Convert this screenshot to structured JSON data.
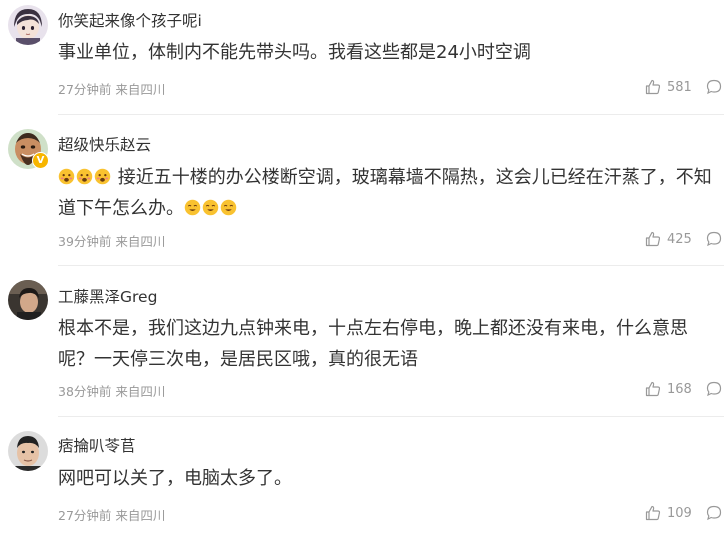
{
  "comments": [
    {
      "username": "你笑起来像个孩子呢i",
      "content": "事业单位，体制内不能先带头吗。我看这些都是24小时空调",
      "time": "27分钟前",
      "location": "来自四川",
      "likes": "581",
      "avatar": "anime-boy-avatar"
    },
    {
      "username": "超级快乐赵云",
      "content_main": "接近五十楼的办公楼断空调，玻璃幕墙不隔热，这会儿已经在汗蒸了，不知道下午怎么办。",
      "verified_badge": "V",
      "time": "39分钟前",
      "location": "来自四川",
      "likes": "425",
      "avatar": "bald-man-avatar",
      "emoji_before": "hot-face",
      "emoji_after": "sweat-smile"
    },
    {
      "username": "工藤黑泽Greg",
      "content": "根本不是，我们这边九点钟来电，十点左右停电，晚上都还没有来电，什么意思呢？一天停三次电，是居民区哦，真的很无语",
      "time": "38分钟前",
      "location": "来自四川",
      "likes": "168",
      "avatar": "dark-photo-avatar"
    },
    {
      "username": "痞掄叭苓苢",
      "content": "网吧可以关了，电脑太多了。",
      "time": "27分钟前",
      "location": "来自四川",
      "likes": "109",
      "avatar": "man-face-avatar"
    }
  ],
  "colors": {
    "text": "#333333",
    "meta": "#999999",
    "divider": "#ececec",
    "badge": "#f7b500",
    "emoji": "#f9c230"
  },
  "icons": {
    "like": "thumbs-up-icon",
    "reply": "comment-bubble-icon"
  }
}
